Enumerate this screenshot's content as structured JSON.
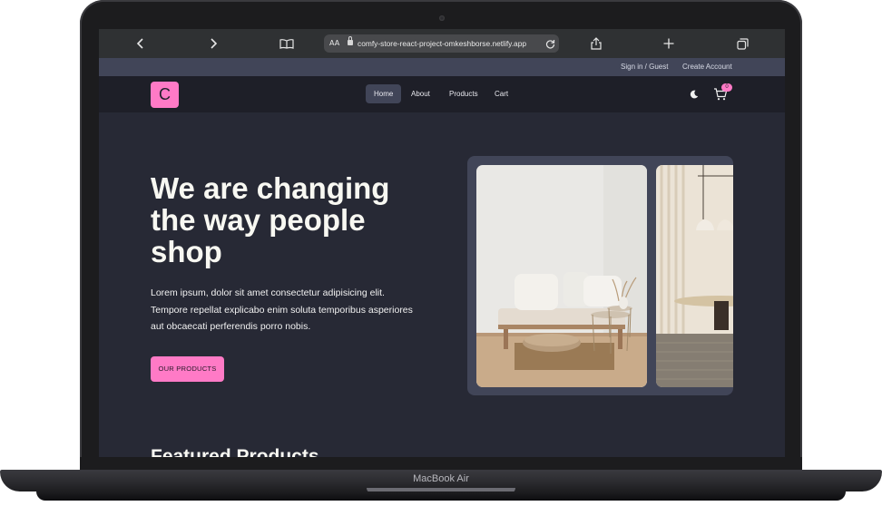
{
  "browser": {
    "url": "comfy-store-react-project-omkeshborse.netlify.app",
    "reader_label": "AA",
    "icons": [
      "back-icon",
      "forward-icon",
      "bookmarks-icon",
      "reload-icon",
      "share-icon",
      "new-tab-icon",
      "tabs-icon"
    ]
  },
  "topbar": {
    "signin_label": "Sign in / Guest",
    "create_account_label": "Create Account"
  },
  "nav": {
    "logo_letter": "C",
    "links": [
      {
        "label": "Home",
        "active": true
      },
      {
        "label": "About",
        "active": false
      },
      {
        "label": "Products",
        "active": false
      },
      {
        "label": "Cart",
        "active": false
      }
    ],
    "cart_count": "0"
  },
  "hero": {
    "title": "We are changing the way people shop",
    "description": "Lorem ipsum, dolor sit amet consectetur adipisicing elit. Tempore repellat explicabo enim soluta temporibus asperiores aut obcaecati perferendis porro nobis.",
    "button_label": "OUR PRODUCTS"
  },
  "featured_heading": "Featured Products",
  "device_label": "MacBook Air",
  "colors": {
    "primary": "#ff7ac6",
    "background": "#272935",
    "nav_bg": "#1e1f28",
    "topbar_bg": "#414558",
    "text": "#f8f8f2"
  }
}
